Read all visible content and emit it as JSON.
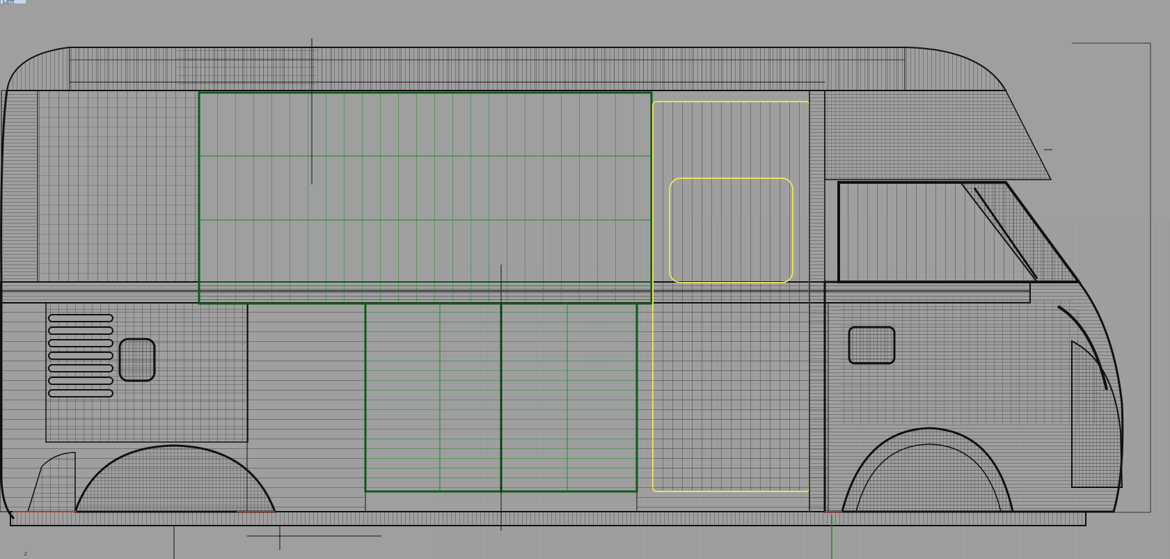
{
  "viewport": {
    "name": "Left",
    "axis": "z"
  },
  "colors": {
    "background": "#9f9f9f",
    "wire": "#1a1a1a",
    "wire_dense": "#2a2a2a",
    "selected_green": "#1b8a2a",
    "selected_yellow": "#e8e060",
    "red_curve": "#c03030",
    "grid": "#8c8c8c"
  },
  "icons": [
    "axis-indicator-icon"
  ]
}
